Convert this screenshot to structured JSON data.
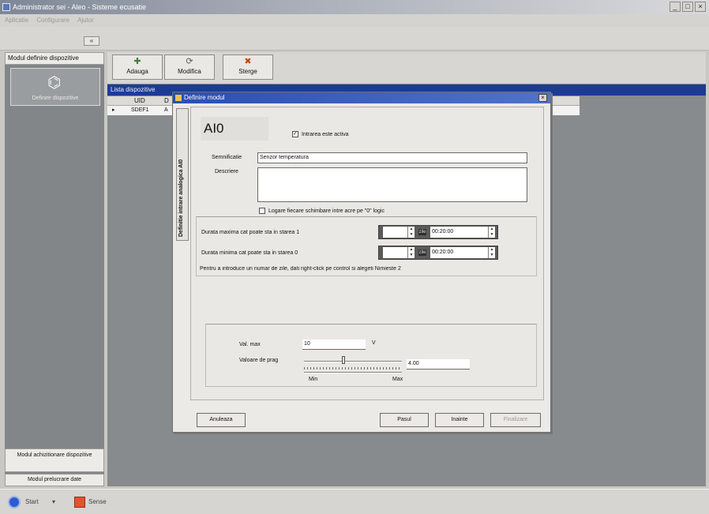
{
  "window": {
    "title": "Administrator sei - Aleo - Sisteme ecusatie"
  },
  "menubar": {
    "items": [
      "Aplicatie",
      "Configurare",
      "Ajutor"
    ]
  },
  "leftnav": {
    "header": "Modul definire dispozitive",
    "active_label": "Definire dispozitive",
    "bottom_item1": "Modul achizitionare dispozitive",
    "bottom_item2": "Modul prelucrare date"
  },
  "toolbar": {
    "add": "Adauga",
    "modify": "Modifica",
    "delete": "Sterge"
  },
  "list": {
    "title": "Lista dispozitive",
    "columns": [
      "UID",
      "D"
    ],
    "rows": [
      [
        "SDEF1",
        "A"
      ]
    ]
  },
  "dialog": {
    "title": "Definire modul",
    "vertical_tab": "Definitie intrare analogica AI0",
    "code": "AI0",
    "active_checkbox_label": "Intrarea este activa",
    "active_checked": true,
    "semnificatie_label": "Semnificatie",
    "semnificatie_value": "Senzor temperatura",
    "descriere_label": "Descriere",
    "descriere_value": "",
    "log_checkbox_label": "Logare fiecare schimbare intre acre pe \"0\" logic",
    "max_duration_label": "Durata maxima cat poate sta in starea 1",
    "min_duration_label": "Durata minima cat poate sta in starea 0",
    "max_time_value": "00:20:00",
    "min_time_value": "00:20:00",
    "zile_label": "zile",
    "hint": "Pentru a introduce un numar de zile, dati right-click pe control si alegeti Nimieste 2",
    "val_max_label": "Val. max",
    "val_max_value": "10",
    "val_max_unit": "V",
    "prag_label": "Valoare de prag",
    "prag_value": "4.00",
    "slider_min_label": "Min",
    "slider_max_label": "Max",
    "prag_fraction": 0.4,
    "buttons": {
      "cancel": "Anuleaza",
      "prev": "Pasul",
      "next": "Inainte",
      "finish": "Finalizare"
    }
  },
  "taskbar": {
    "start": "Start",
    "item": "Sense"
  }
}
